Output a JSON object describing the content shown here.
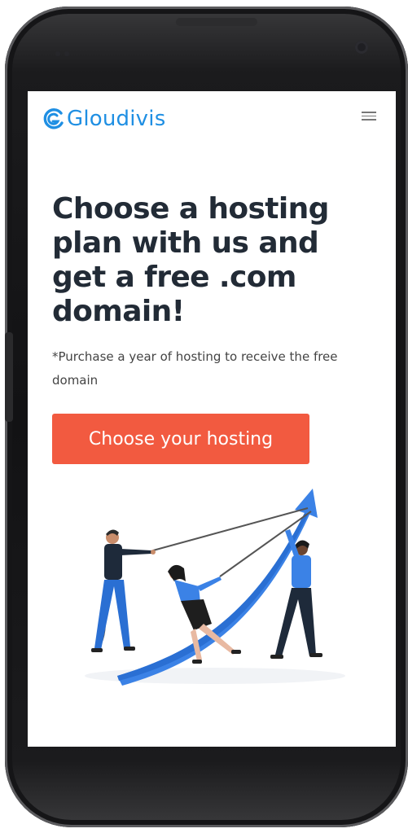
{
  "header": {
    "logo_text": "Gloudivis",
    "menu_icon": "hamburger-menu-icon"
  },
  "hero": {
    "title": "Choose a hosting plan with us and get a free .com domain!",
    "subtitle": "*Purchase a year of hosting to receive the free domain",
    "cta_label": "Choose your hosting"
  },
  "illustration": {
    "description_icon": "team-pulling-growth-arrow-illustration"
  },
  "colors": {
    "brand_blue": "#1f8fe3",
    "cta_orange": "#f25a40",
    "title_dark": "#222b36",
    "illustration_blue": "#3b82e6"
  }
}
